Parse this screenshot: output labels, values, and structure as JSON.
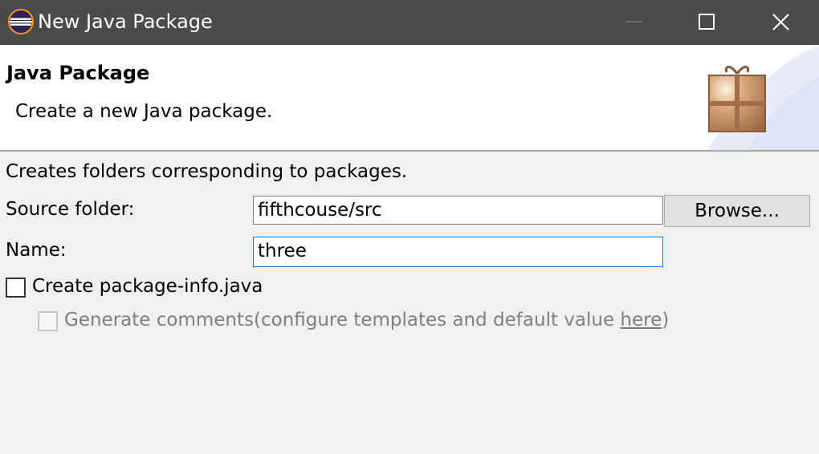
{
  "window": {
    "title": "New Java Package",
    "minimize_icon": "minimize-icon",
    "maximize_icon": "maximize-icon",
    "close_icon": "close-icon"
  },
  "banner": {
    "title": "Java Package",
    "description": "Create a new Java package.",
    "icon": "package-gift-icon"
  },
  "form": {
    "info": "Creates folders corresponding to packages.",
    "source_folder_label": "Source folder:",
    "source_folder_value": "fifthcouse/src",
    "browse_label": "Browse...",
    "name_label": "Name:",
    "name_value": "three",
    "create_package_info_label": "Create package-info.java",
    "create_package_info_checked": false,
    "generate_comments_label": "Generate comments",
    "generate_comments_checked": false,
    "generate_comments_enabled": false,
    "configure_prefix": "(configure templates and default value ",
    "configure_link": "here",
    "configure_suffix": ")"
  }
}
